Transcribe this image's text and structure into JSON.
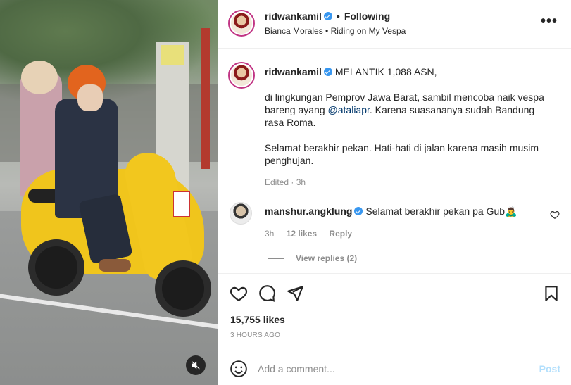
{
  "post": {
    "media": {
      "mute_icon": "speaker-muted-icon"
    },
    "header": {
      "username": "ridwankamil",
      "follow_status": "Following",
      "separator": "•",
      "audio_text": "Bianca Morales • Riding on My Vespa",
      "more_label": "•••"
    },
    "caption": {
      "username": "ridwankamil",
      "headline": "MELANTIK 1,088 ASN,",
      "para1_before": "di lingkungan Pemprov Jawa Barat, sambil mencoba naik vespa bareng ayang ",
      "mention": "@ataliapr",
      "para1_after": ". Karena suasananya sudah Bandung rasa Roma.",
      "para2": "Selamat berakhir pekan. Hati-hati di jalan karena masih musim penghujan.",
      "edited": "Edited · 3h"
    },
    "comment": {
      "username": "manshur.angklung",
      "text": "Selamat berakhir pekan pa Gub🙇‍♂️",
      "time": "3h",
      "likes": "12 likes",
      "reply": "Reply",
      "view_replies": "View replies (2)"
    },
    "stats": {
      "likes": "15,755 likes",
      "timestamp": "3 HOURS AGO"
    },
    "add_comment": {
      "placeholder": "Add a comment...",
      "post_label": "Post"
    }
  },
  "colors": {
    "verified": "#3897f0",
    "mention": "#00376b",
    "post_disabled": "#b2dffc",
    "muted_text": "#8e8e8e"
  }
}
